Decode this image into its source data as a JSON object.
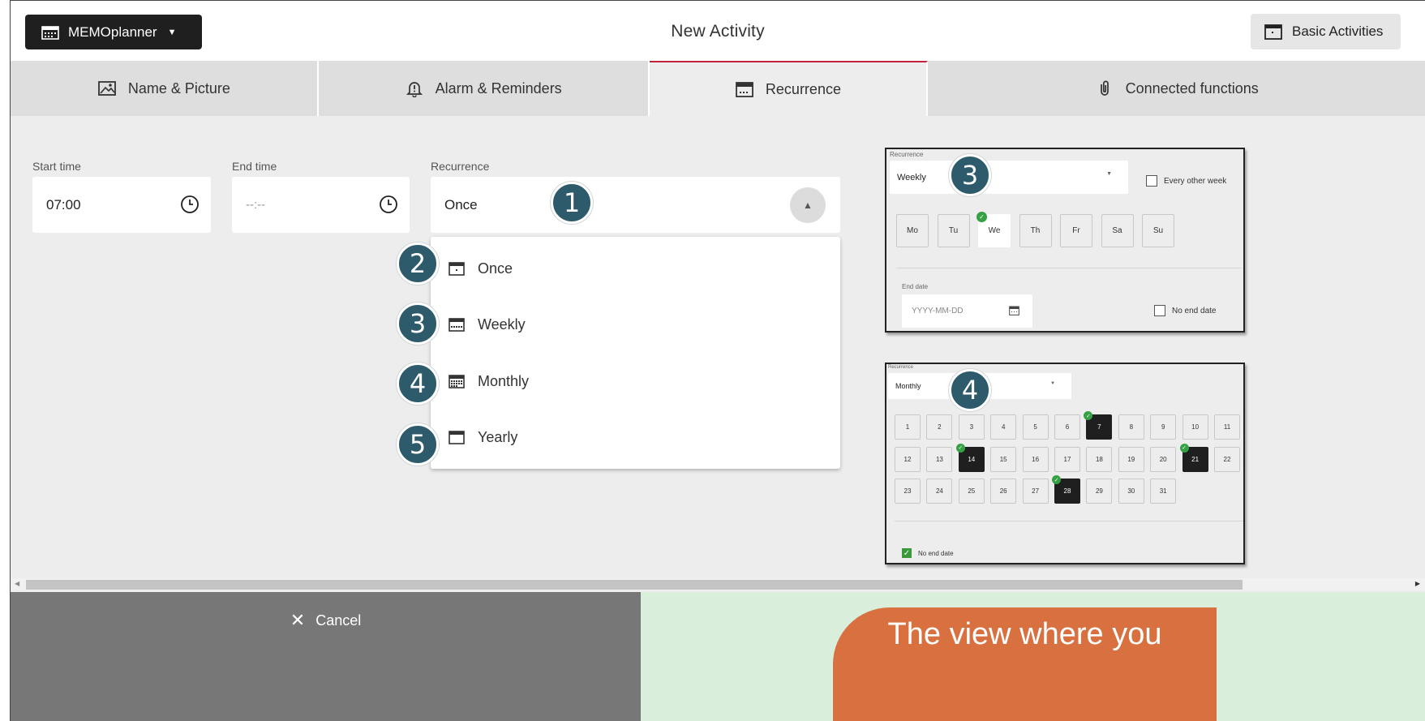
{
  "header": {
    "app_name": "MEMOplanner",
    "title": "New Activity",
    "basic_activities_label": "Basic Activities"
  },
  "tabs": [
    {
      "label": "Name & Picture",
      "icon": "picture-icon"
    },
    {
      "label": "Alarm & Reminders",
      "icon": "alarm-icon"
    },
    {
      "label": "Recurrence",
      "icon": "calendar-icon",
      "active": true
    },
    {
      "label": "Connected functions",
      "icon": "paperclip-icon"
    }
  ],
  "form": {
    "start_time_label": "Start time",
    "start_time_value": "07:00",
    "end_time_label": "End time",
    "end_time_placeholder": "--:--",
    "recurrence_label": "Recurrence",
    "recurrence_value": "Once"
  },
  "dropdown_options": [
    {
      "label": "Once",
      "badge": "2"
    },
    {
      "label": "Weekly",
      "badge": "3"
    },
    {
      "label": "Monthly",
      "badge": "4"
    },
    {
      "label": "Yearly",
      "badge": "5"
    }
  ],
  "badges": {
    "recurrence_field": "1",
    "weekly_preview": "3",
    "monthly_preview": "4"
  },
  "weekly_preview": {
    "label": "Recurrence",
    "value": "Weekly",
    "every_other_week_label": "Every other week",
    "days": [
      {
        "label": "Mo",
        "selected": false
      },
      {
        "label": "Tu",
        "selected": false
      },
      {
        "label": "We",
        "selected": true
      },
      {
        "label": "Th",
        "selected": false
      },
      {
        "label": "Fr",
        "selected": false
      },
      {
        "label": "Sa",
        "selected": false
      },
      {
        "label": "Su",
        "selected": false
      }
    ],
    "end_date_label": "End date",
    "end_date_placeholder": "YYYY-MM-DD",
    "no_end_date_label": "No end date"
  },
  "monthly_preview": {
    "label": "Recurrence",
    "value": "Monthly",
    "selected_days": [
      7,
      14,
      21,
      28
    ],
    "no_end_date_label": "No end date",
    "no_end_date_checked": true
  },
  "footer": {
    "cancel_label": "Cancel",
    "callout_text": "The view where you"
  },
  "colors": {
    "accent": "#c2213a",
    "badge": "#2d5b6b",
    "check_green": "#35a044",
    "callout": "#d8703f",
    "footer_right": "#d9eedb"
  }
}
